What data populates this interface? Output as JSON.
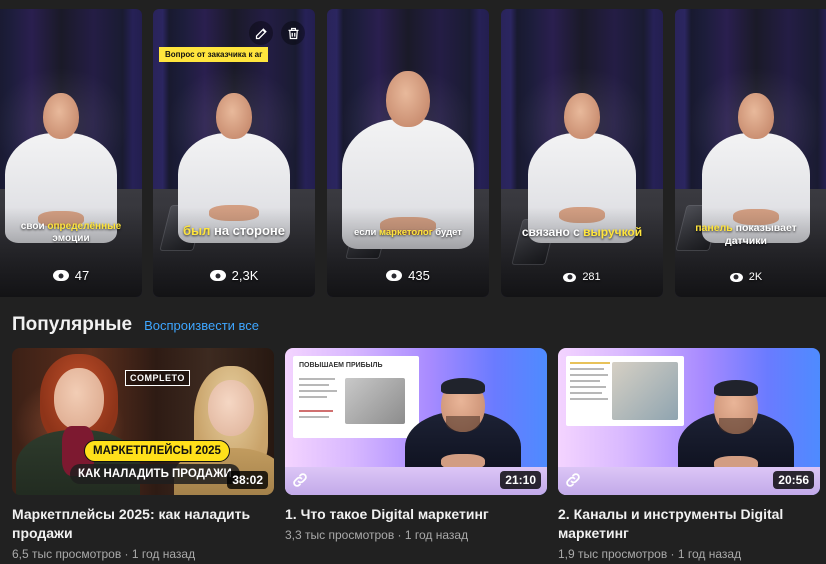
{
  "shorts": [
    {
      "caption_plain_before": "свои ",
      "caption_highlight": "определённые",
      "caption_plain_after": "эмоции",
      "views": "47"
    },
    {
      "badge": "Вопрос от заказчика к аг",
      "caption_highlight": "был",
      "caption_plain_after": " на стороне",
      "views": "2,3K",
      "edit_icon": "pencil-icon",
      "delete_icon": "trash-icon"
    },
    {
      "caption_plain_before": "если ",
      "caption_highlight": "маркетолог",
      "caption_plain_after": " будет",
      "views": "435"
    },
    {
      "caption_plain_before": "связано с ",
      "caption_highlight": "выручкой",
      "views": "281"
    },
    {
      "caption_highlight": "панель",
      "caption_plain_after": " показывает",
      "caption_line2": "датчики",
      "views": "2K"
    }
  ],
  "popular": {
    "title": "Популярные",
    "play_all": "Воспроизвести все",
    "videos": [
      {
        "title": "Маркетплейсы 2025: как наладить продажи",
        "meta": "6,5 тыс просмотров · 1 год назад",
        "duration": "38:02",
        "thumb_logo": "COMPLETO",
        "thumb_pill1": "МАРКЕТПЛЕЙСЫ 2025",
        "thumb_pill2": "КАК НАЛАДИТЬ ПРОДАЖИ"
      },
      {
        "title": "1. Что такое Digital маркетинг",
        "meta": "3,3 тыс просмотров · 1 год назад",
        "duration": "21:10",
        "slide_title": "ПОВЫШАЕМ ПРИБЫЛЬ",
        "link_icon": "link-icon"
      },
      {
        "title": "2. Каналы и инструменты Digital маркетинг",
        "meta": "1,9 тыс просмотров · 1 год назад",
        "duration": "20:56",
        "link_icon": "link-icon"
      }
    ]
  },
  "colors": {
    "background": "#212121",
    "link": "#3ea6ff",
    "caption_highlight": "#ffe53d",
    "meta_text": "#aaaaaa"
  }
}
